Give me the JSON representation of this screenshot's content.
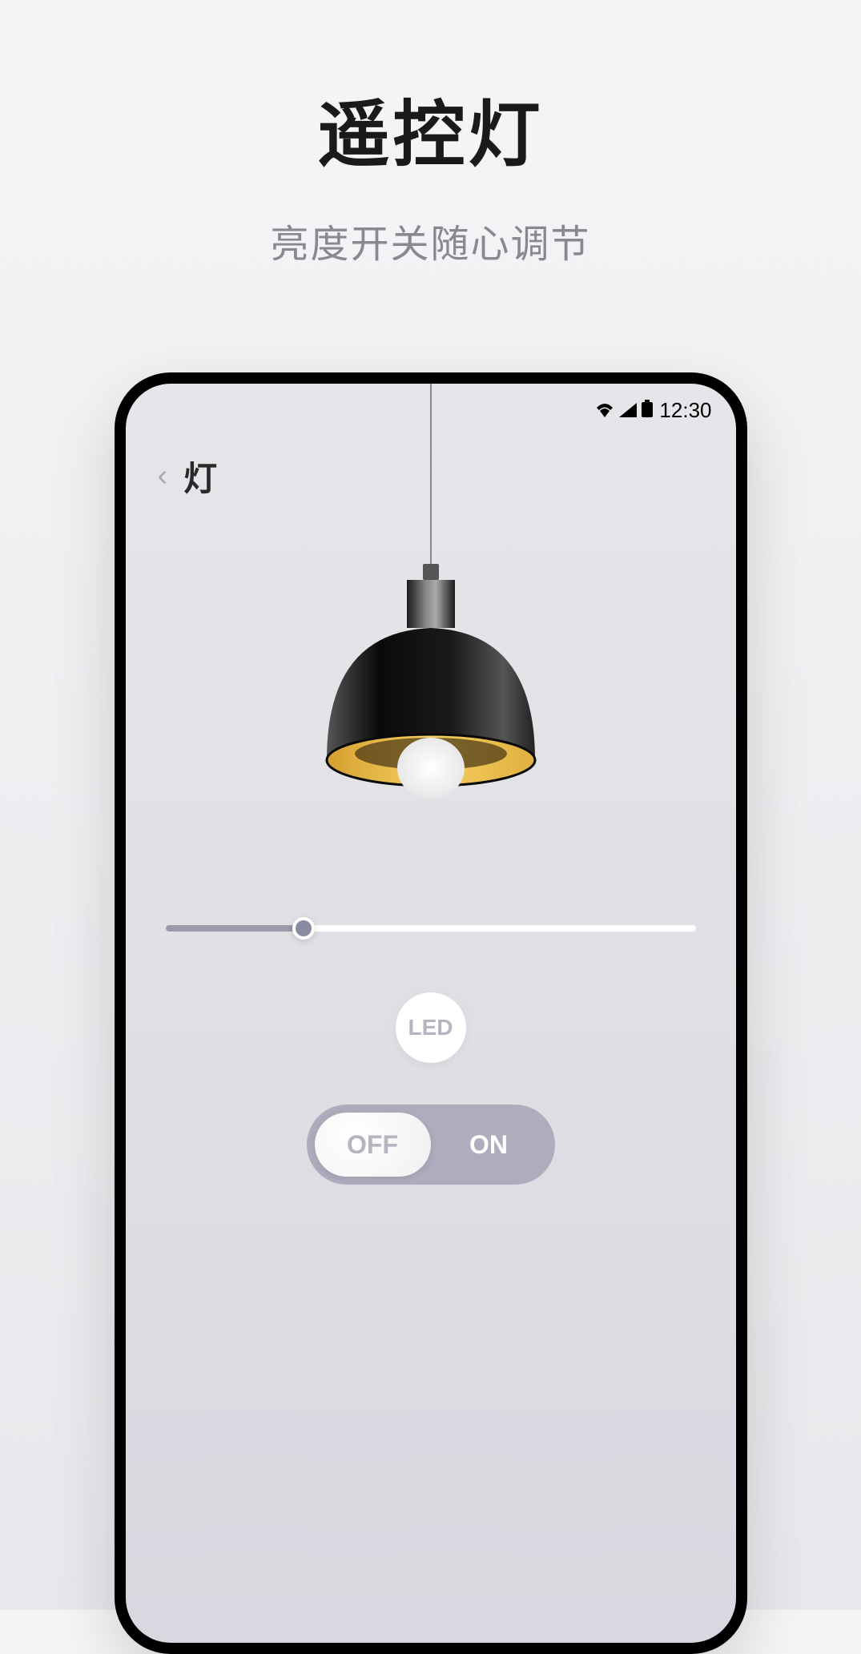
{
  "page": {
    "title": "遥控灯",
    "subtitle": "亮度开关随心调节"
  },
  "statusbar": {
    "time": "12:30"
  },
  "header": {
    "title": "灯"
  },
  "led": {
    "label": "LED"
  },
  "slider": {
    "value": 26,
    "min": 0,
    "max": 100
  },
  "toggle": {
    "off_label": "OFF",
    "on_label": "ON",
    "state": "off"
  },
  "icons": {
    "back": "‹",
    "wifi": "wifi-icon",
    "signal": "signal-icon",
    "battery": "battery-icon"
  }
}
